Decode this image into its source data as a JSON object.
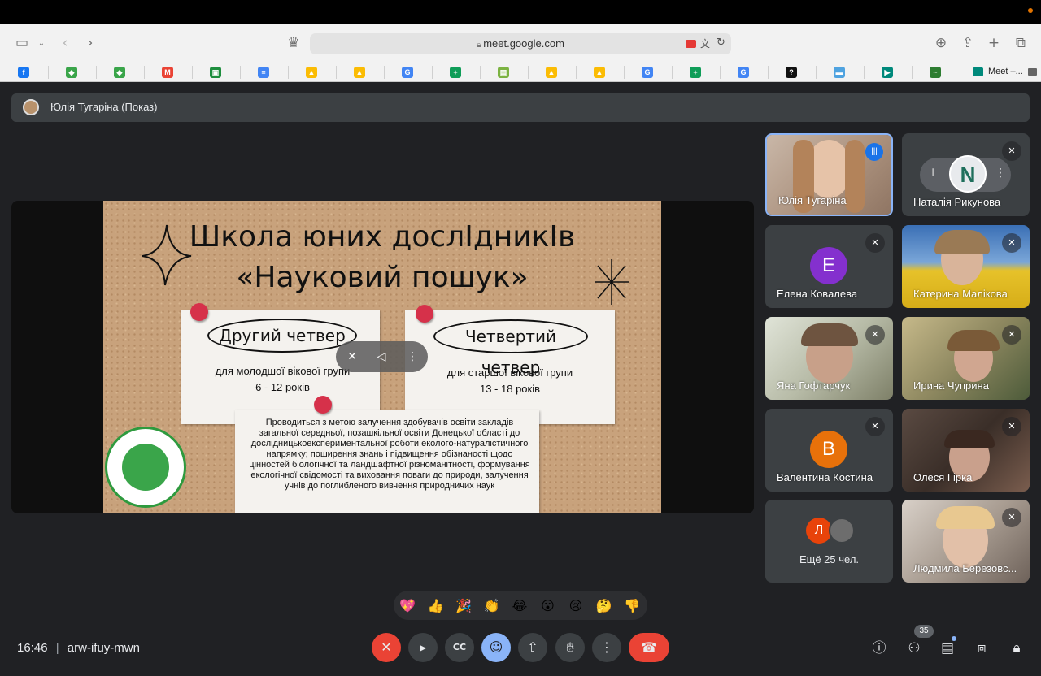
{
  "browser": {
    "url": "meet.google.com",
    "bookmarks": [
      {
        "icon": "facebook-icon",
        "color": "#1877f2",
        "glyph": "f"
      },
      {
        "icon": "shield-site-icon",
        "color": "#3aa54a",
        "glyph": "◆"
      },
      {
        "icon": "shield-site-icon",
        "color": "#3aa54a",
        "glyph": "◆"
      },
      {
        "icon": "gmail-icon",
        "color": "#ea4335",
        "glyph": "M"
      },
      {
        "icon": "classroom-icon",
        "color": "#1e8e3e",
        "glyph": "▣"
      },
      {
        "icon": "docs-icon",
        "color": "#4285f4",
        "glyph": "≡"
      },
      {
        "icon": "drive-icon",
        "color": "#fbbc04",
        "glyph": "▲"
      },
      {
        "icon": "drive-icon",
        "color": "#fbbc04",
        "glyph": "▲"
      },
      {
        "icon": "google-icon",
        "color": "#4285f4",
        "glyph": "G"
      },
      {
        "icon": "sheets-icon",
        "color": "#0f9d58",
        "glyph": "+"
      },
      {
        "icon": "forms-icon",
        "color": "#7cb342",
        "glyph": "▤"
      },
      {
        "icon": "drive-icon",
        "color": "#fbbc04",
        "glyph": "▲"
      },
      {
        "icon": "drive-icon",
        "color": "#fbbc04",
        "glyph": "▲"
      },
      {
        "icon": "google-icon",
        "color": "#4285f4",
        "glyph": "G"
      },
      {
        "icon": "sheets-icon",
        "color": "#0f9d58",
        "glyph": "+"
      },
      {
        "icon": "google-icon",
        "color": "#4285f4",
        "glyph": "G"
      },
      {
        "icon": "help-icon",
        "color": "#111111",
        "glyph": "?"
      },
      {
        "icon": "docs-blue-icon",
        "color": "#4fa3e0",
        "glyph": "▬"
      },
      {
        "icon": "meet-icon",
        "color": "#00897b",
        "glyph": "▶"
      },
      {
        "icon": "lake-icon",
        "color": "#2e7d32",
        "glyph": "~"
      }
    ],
    "active_tab": "Meet –..."
  },
  "presenter_bar": {
    "label": "Юлія Тугаріна (Показ)"
  },
  "slide": {
    "title_line1": "Школа юних дослІдникІв",
    "title_line2": "«Науковий пошук»",
    "note1_heading": "Другий четвер",
    "note1_text1": "для молодшої вікової групи",
    "note1_text2": "6 - 12 років",
    "note2_heading": "Четвертий четвер",
    "note2_text1": "для старшої вікової групи",
    "note2_text2": "13 - 18 років",
    "description": "Проводиться з метою залучення здобувачів освіти закладів загальної середньої, позашкільної освіти Донецької області до дослідницькоекспериментальної роботи еколого-натуралістичного напрямку; поширення знань і підвищення обізнаності щодо цінностей біологічної та ландшафтної різноманітності, формування екологічної свідомості та виховання поваги до природи, залучення учнів до поглибленого вивчення природничих наук"
  },
  "participants": [
    {
      "name": "Юлія Тугаріна",
      "kind": "video",
      "speaking": true
    },
    {
      "name": "Наталія Рикунова",
      "kind": "avatar",
      "initial": "N"
    },
    {
      "name": "Елена Ковалева",
      "kind": "letter",
      "initial": "E",
      "color": "#8430ce"
    },
    {
      "name": "Катерина Малікова",
      "kind": "video"
    },
    {
      "name": "Яна Гофтарчук",
      "kind": "video"
    },
    {
      "name": "Ирина Чуприна",
      "kind": "video"
    },
    {
      "name": "Валентина Костина",
      "kind": "letter",
      "initial": "B",
      "color": "#e8710a"
    },
    {
      "name": "Олеся Гірка",
      "kind": "video"
    },
    {
      "name": "Ещё 25 чел.",
      "kind": "more",
      "initial": "Л",
      "color": "#e8430a"
    },
    {
      "name": "Людмила Березовс...",
      "kind": "video"
    }
  ],
  "reactions": [
    "💖",
    "👍",
    "🎉",
    "👏",
    "😂",
    "😮",
    "😢",
    "🤔",
    "👎"
  ],
  "meeting": {
    "time": "16:46",
    "separator": "|",
    "code": "arw-ifuy-mwn",
    "participant_count": "35"
  }
}
